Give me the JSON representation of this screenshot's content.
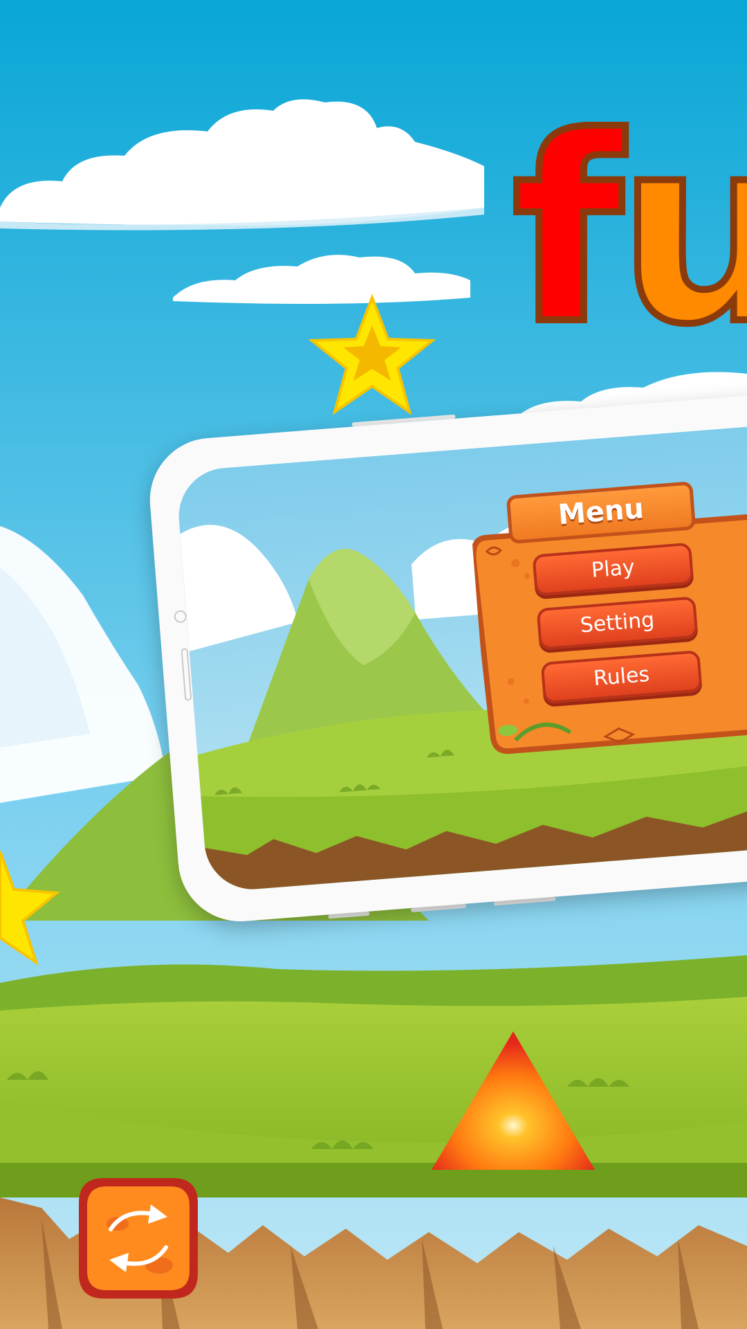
{
  "title": {
    "part1": "f",
    "part2": "u"
  },
  "phone_screenshot": {
    "menu": {
      "title": "Menu",
      "buttons": [
        {
          "label": "Play"
        },
        {
          "label": "Setting"
        },
        {
          "label": "Rules"
        }
      ],
      "close_icon": "close-icon"
    }
  },
  "refresh_button": {
    "icon": "refresh-icon"
  },
  "colors": {
    "sky_top": "#0AA7D6",
    "sky_bottom": "#8FD6F0",
    "title_red": "#FF0000",
    "title_orange": "#FF8A00",
    "title_outline": "#8B3A0B",
    "star": "#FFE600",
    "menu_orange": "#F68A2B",
    "button_red": "#E84A22"
  }
}
